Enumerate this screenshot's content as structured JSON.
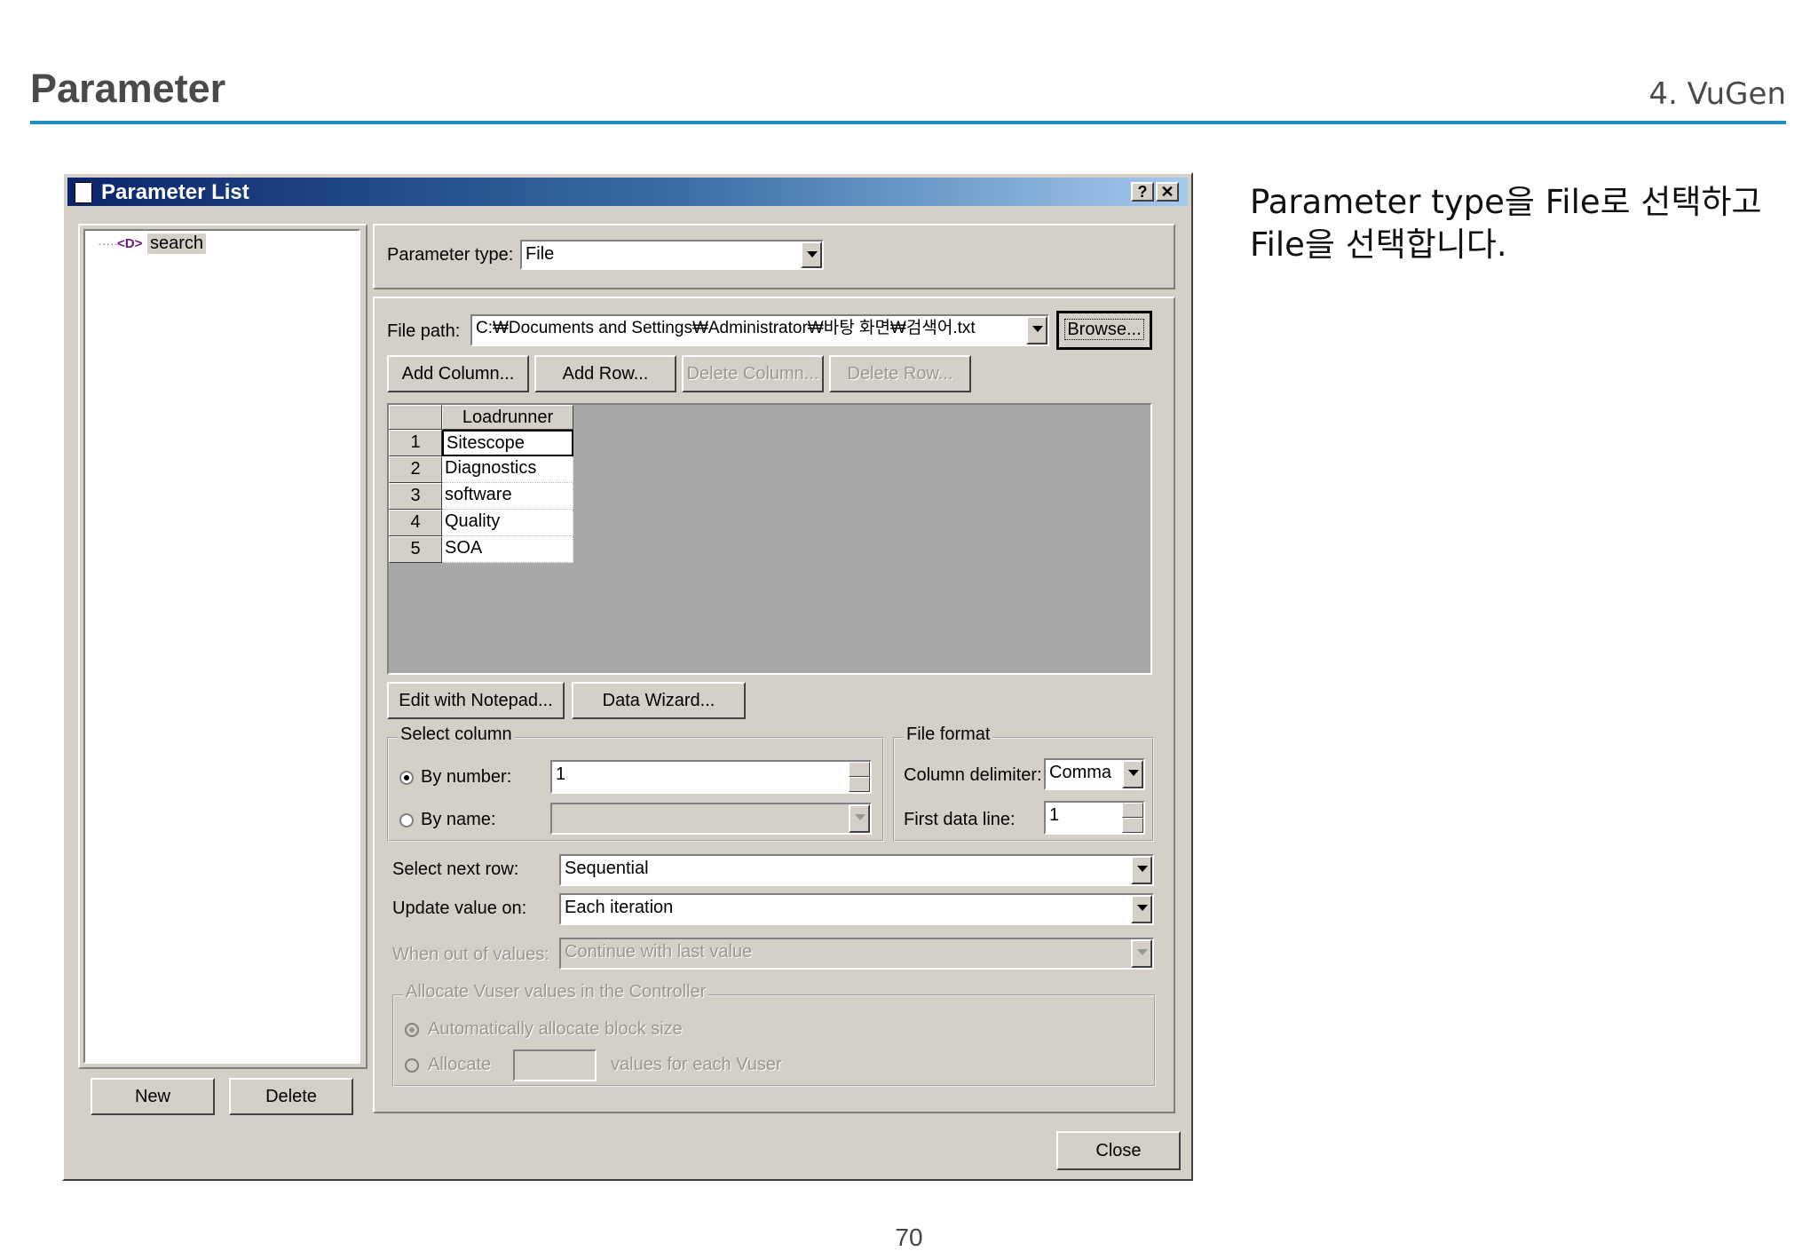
{
  "slide": {
    "title": "Parameter",
    "section": "4. VuGen",
    "description": "Parameter type을 File로 선택하고 File을 선택합니다.",
    "page_number": "70"
  },
  "dialog": {
    "title": "Parameter List",
    "help_btn": "?",
    "close_btn": "✕",
    "tree": {
      "connector": "·····",
      "param_glyph": "<D>",
      "item_label": "search"
    },
    "left_buttons": {
      "new": "New",
      "delete": "Delete"
    },
    "parameter_type": {
      "label": "Parameter type:",
      "value": "File"
    },
    "file_path": {
      "label": "File path:",
      "value": "C:₩Documents and Settings₩Administrator₩바탕 화면₩검색어.txt",
      "browse": "Browse..."
    },
    "grid_buttons": {
      "add_column": "Add Column...",
      "add_row": "Add Row...",
      "delete_column": "Delete Column...",
      "delete_row": "Delete Row..."
    },
    "grid": {
      "column_header": "Loadrunner",
      "rows": [
        {
          "num": "1",
          "value": "Sitescope"
        },
        {
          "num": "2",
          "value": "Diagnostics"
        },
        {
          "num": "3",
          "value": "software"
        },
        {
          "num": "4",
          "value": "Quality"
        },
        {
          "num": "5",
          "value": "SOA"
        }
      ]
    },
    "edit_notepad": "Edit with Notepad...",
    "data_wizard": "Data Wizard...",
    "select_column": {
      "legend": "Select column",
      "by_number_label": "By number:",
      "by_number_value": "1",
      "by_name_label": "By name:"
    },
    "file_format": {
      "legend": "File format",
      "column_delimiter_label": "Column delimiter:",
      "column_delimiter_value": "Comma",
      "first_data_line_label": "First data line:",
      "first_data_line_value": "1"
    },
    "select_next_row": {
      "label": "Select next row:",
      "value": "Sequential"
    },
    "update_value_on": {
      "label": "Update value on:",
      "value": "Each iteration"
    },
    "when_out_of_values": {
      "label": "When out of values:",
      "value": "Continue with last value"
    },
    "allocate": {
      "legend": "Allocate Vuser values in the Controller",
      "auto_label": "Automatically allocate block size",
      "allocate_label": "Allocate",
      "values_suffix": "values for each Vuser"
    },
    "close": "Close"
  }
}
